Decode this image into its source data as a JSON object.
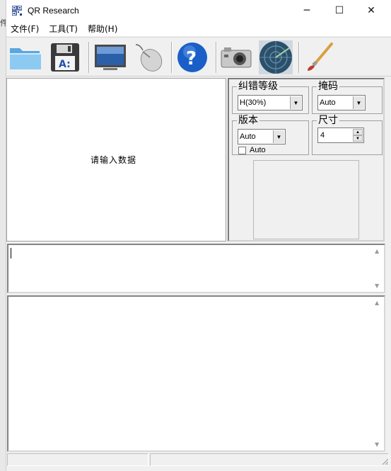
{
  "window": {
    "title": "QR Research"
  },
  "background_fragment": "件",
  "controls": {
    "minimize": "─",
    "maximize": "☐",
    "close": "✕"
  },
  "menu": [
    "文件(F)",
    "工具(T)",
    "帮助(H)"
  ],
  "toolbar": [
    {
      "name": "open-folder-icon"
    },
    {
      "name": "save-floppy-icon"
    },
    {
      "name": "monitor-icon"
    },
    {
      "name": "mouse-icon"
    },
    {
      "name": "help-icon"
    },
    {
      "name": "camera-icon"
    },
    {
      "name": "radar-icon"
    },
    {
      "name": "brush-icon"
    }
  ],
  "input": {
    "prompt": "请输入数据"
  },
  "settings": {
    "ecc": {
      "legend": "纠错等级",
      "value": "H(30%)"
    },
    "mask": {
      "legend": "掩码",
      "value": "Auto"
    },
    "version": {
      "legend": "版本",
      "value": "Auto",
      "checkbox_label": "Auto",
      "checked": false
    },
    "size": {
      "legend": "尺寸",
      "value": "4"
    }
  },
  "colors": {
    "accent_blue": "#1a5fc8",
    "panel_bg": "#f0f0f0"
  }
}
